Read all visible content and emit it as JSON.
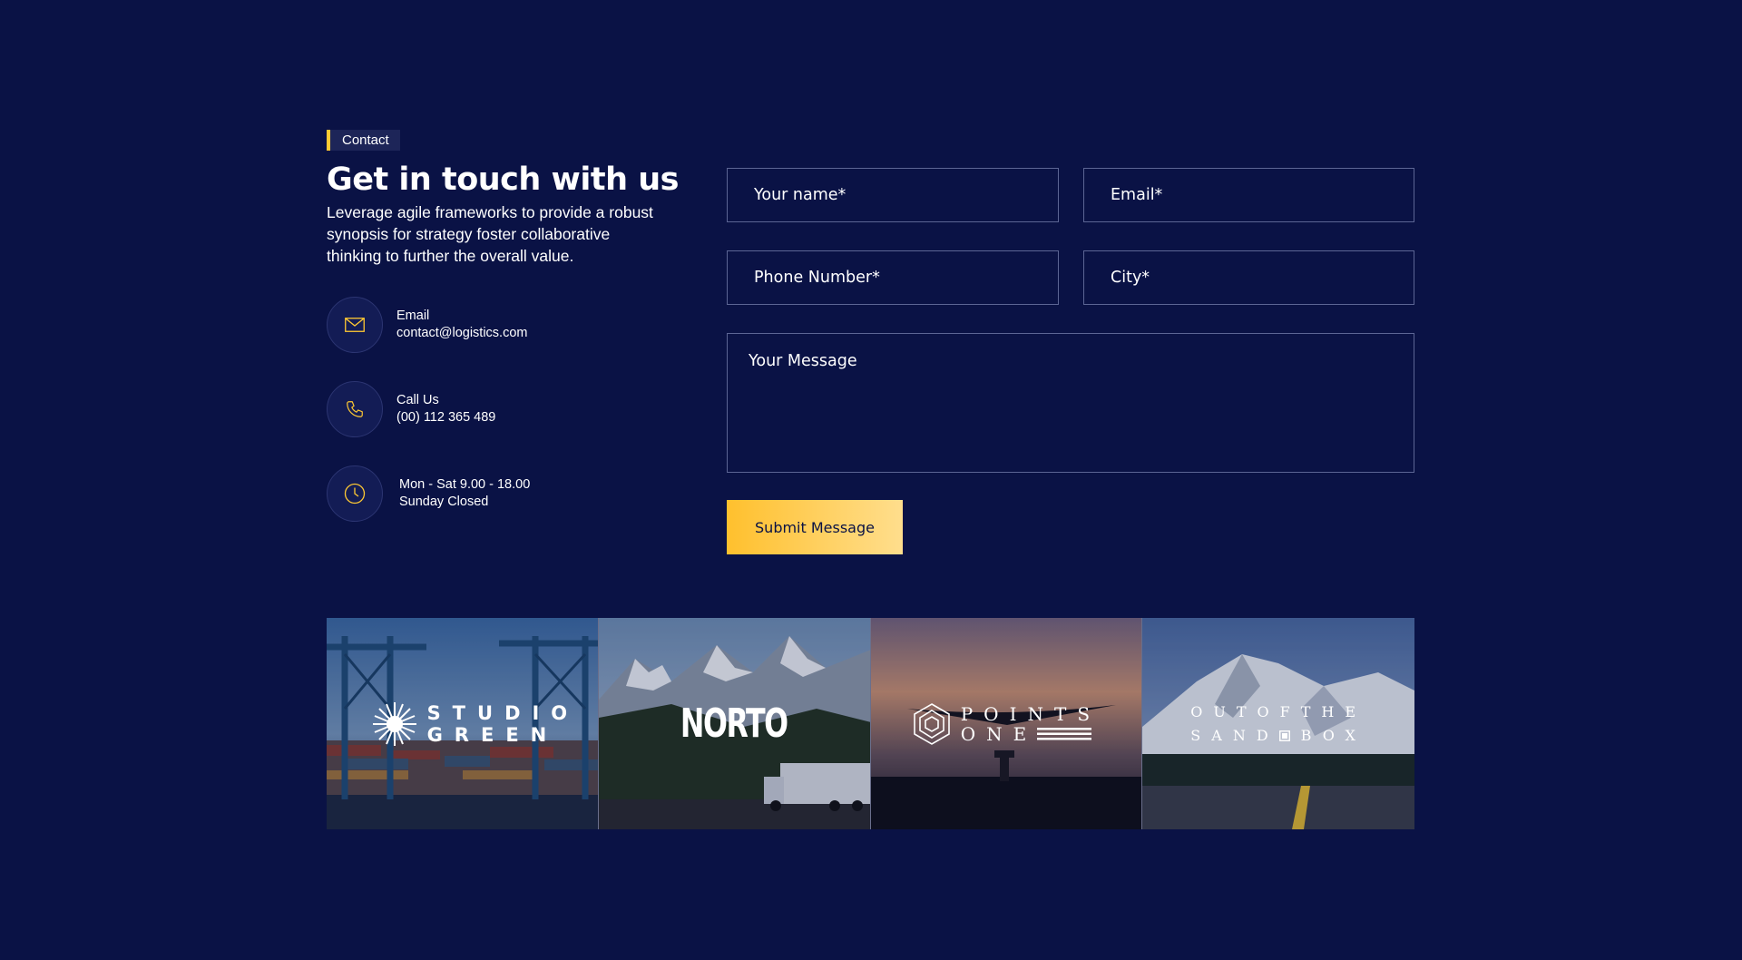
{
  "tag": {
    "label": "Contact"
  },
  "heading": "Get in touch with us",
  "lead": "Leverage agile frameworks to provide a robust synopsis for strategy foster collaborative thinking to further the overall value.",
  "contact": {
    "email": {
      "icon": "envelope-icon",
      "title": "Email",
      "value": "contact@logistics.com"
    },
    "phone": {
      "icon": "phone-icon",
      "title": "Call Us",
      "value": "(00) 112 365 489"
    },
    "hours": {
      "icon": "clock-icon",
      "title": "Mon - Sat 9.00 - 18.00",
      "value": "Sunday Closed"
    }
  },
  "form": {
    "name_placeholder": "Your name*",
    "email_placeholder": "Email*",
    "phone_placeholder": "Phone Number*",
    "city_placeholder": "City*",
    "message_placeholder": "Your Message",
    "submit_label": "Submit Message"
  },
  "gallery": {
    "studio": {
      "line1": "STUDIO",
      "line2": "GREEN"
    },
    "norto": {
      "name": "NORTO"
    },
    "points": {
      "line1": "POINTS",
      "line2": "ONE"
    },
    "sandbox": {
      "line1": "OUTOFTHE",
      "line2a": "SAND",
      "line2b": "BOX"
    }
  },
  "colors": {
    "background": "#0a1245",
    "accent": "#ffc933",
    "border": "#5c6594"
  }
}
